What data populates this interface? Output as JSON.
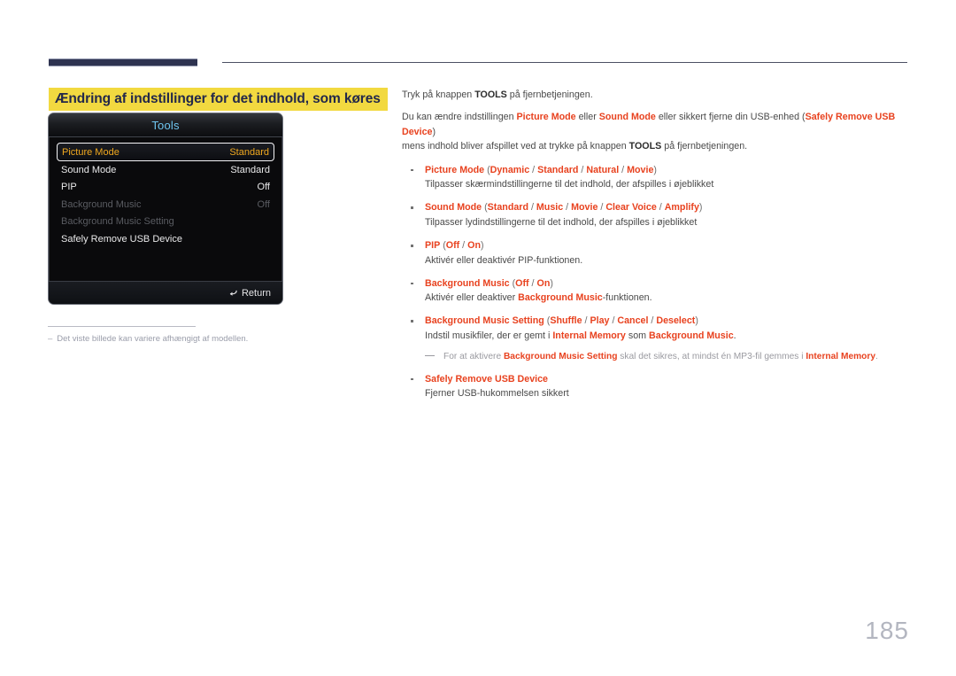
{
  "header": {
    "bar_color": "#2e3350",
    "line_color": "#4c5064"
  },
  "section": {
    "title": "Ændring af indstillinger for det indhold, som køres",
    "highlight_color": "#f2d940",
    "text_color": "#23284a"
  },
  "osd": {
    "title": "Tools",
    "title_color": "#6fc6f0",
    "selected_color": "#f0a81e",
    "rows": [
      {
        "label": "Picture Mode",
        "value": "Standard",
        "state": "selected"
      },
      {
        "label": "Sound Mode",
        "value": "Standard",
        "state": "normal"
      },
      {
        "label": "PIP",
        "value": "Off",
        "state": "normal"
      },
      {
        "label": "Background Music",
        "value": "Off",
        "state": "dim"
      },
      {
        "label": "Background Music Setting",
        "value": "",
        "state": "dim"
      },
      {
        "label": "Safely Remove USB Device",
        "value": "",
        "state": "normal"
      }
    ],
    "footer": {
      "return_label": "Return",
      "return_icon": "return-arrow-icon",
      "return_glyph": "↩"
    }
  },
  "footnote": {
    "dash": "–",
    "text": "Det viste billede kan variere afhængigt af modellen."
  },
  "content": {
    "accent_color": "#e8421f",
    "intro_1": {
      "pre": "Tryk på knappen ",
      "bold": "TOOLS",
      "post": " på fjernbetjeningen."
    },
    "intro_2": {
      "p1": "Du kan ændre indstillingen ",
      "r1": "Picture Mode",
      "p2": " eller ",
      "r2": "Sound Mode",
      "p3": " eller sikkert fjerne din USB-enhed (",
      "r3": "Safely Remove USB Device",
      "p4": ")",
      "p5": "mens indhold bliver afspillet ved at trykke på knappen ",
      "b1": "TOOLS",
      "p6": " på fjernbetjeningen."
    },
    "bullets": [
      {
        "name": "Picture Mode",
        "options": [
          "Dynamic",
          "Standard",
          "Natural",
          "Movie"
        ],
        "desc": "Tilpasser skærmindstillingerne til det indhold, der afspilles i øjeblikket"
      },
      {
        "name": "Sound Mode",
        "options": [
          "Standard",
          "Music",
          "Movie",
          "Clear Voice",
          "Amplify"
        ],
        "desc": "Tilpasser lydindstillingerne til det indhold, der afspilles i øjeblikket"
      },
      {
        "name": "PIP",
        "options": [
          "Off",
          "On"
        ],
        "desc": "Aktivér eller deaktivér PIP-funktionen."
      },
      {
        "name": "Background Music",
        "options": [
          "Off",
          "On"
        ],
        "desc_pre": "Aktivér eller deaktiver ",
        "desc_r": "Background Music",
        "desc_post": "-funktionen."
      },
      {
        "name": "Background Music Setting",
        "options": [
          "Shuffle",
          "Play",
          "Cancel",
          "Deselect"
        ],
        "desc_pre": "Indstil musikfiler, der er gemt i ",
        "desc_r1": "Internal Memory",
        "desc_mid": " som ",
        "desc_r2": "Background Music",
        "desc_post": "."
      },
      {
        "name": "Safely Remove USB Device",
        "options": [],
        "desc": "Fjerner USB-hukommelsen sikkert"
      }
    ],
    "note": {
      "p1": "For at aktivere ",
      "r1": "Background Music Setting",
      "p2": " skal det sikres, at mindst én MP3-fil gemmes i ",
      "r2": "Internal Memory",
      "p3": "."
    }
  },
  "page": {
    "number": "185"
  }
}
